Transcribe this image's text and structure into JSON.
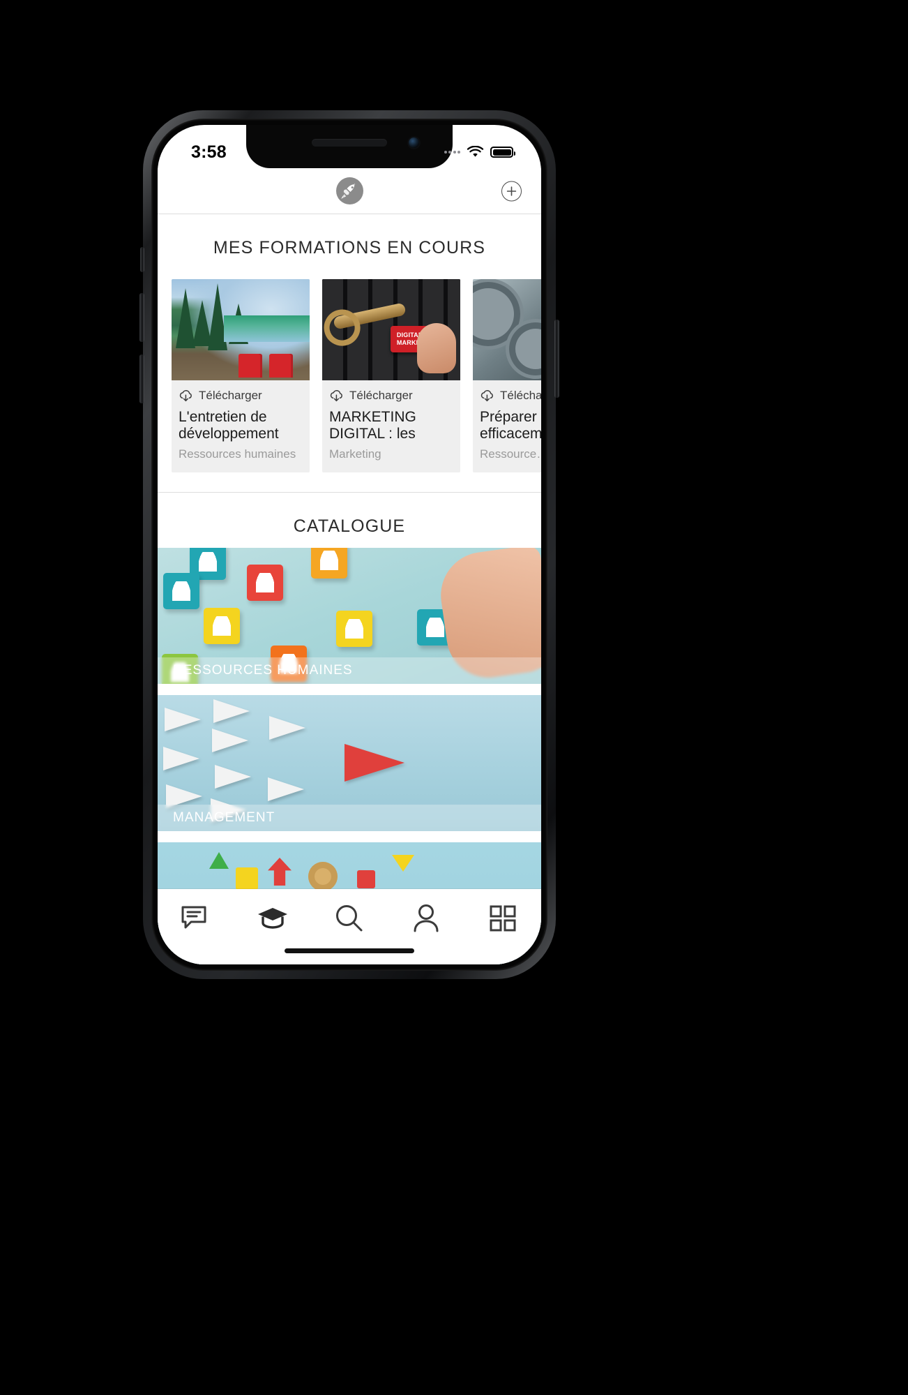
{
  "status_bar": {
    "time": "3:58",
    "signal_icon": "signal-dots-icon",
    "wifi_icon": "wifi-icon",
    "battery_icon": "battery-full-icon"
  },
  "header": {
    "logo_icon": "rocket-logo-icon",
    "add_button_icon": "plus-circle-icon",
    "add_button_label": "+"
  },
  "sections": {
    "in_progress": {
      "title": "MES FORMATIONS EN COURS",
      "courses": [
        {
          "download_label": "Télécharger",
          "download_icon": "cloud-download-icon",
          "title": "L'entretien de développement",
          "category": "Ressources humaines",
          "image_alt": "lake-forest-red-chairs"
        },
        {
          "download_label": "Télécharger",
          "download_icon": "cloud-download-icon",
          "title": "MARKETING DIGITAL : les suppo…",
          "category": "Marketing",
          "image_alt": "keyboard-digital-marketing-key"
        },
        {
          "download_label": "Télécharg…",
          "download_icon": "cloud-download-icon",
          "title": "Préparer efficacem…",
          "category": "Ressource…",
          "image_alt": "metal-gears-machinery"
        }
      ]
    },
    "catalogue": {
      "title": "CATALOGUE",
      "categories": [
        {
          "label": "RESSOURCES HUMAINES",
          "image_alt": "colorful-person-blocks-hand"
        },
        {
          "label": "MANAGEMENT",
          "image_alt": "paper-planes-red-leader"
        },
        {
          "label": "",
          "image_alt": "office-tools-flat-lay"
        }
      ]
    }
  },
  "tab_bar": {
    "items": [
      {
        "name": "messages",
        "icon": "chat-bubble-icon",
        "active": false
      },
      {
        "name": "training",
        "icon": "graduation-cap-icon",
        "active": true
      },
      {
        "name": "search",
        "icon": "magnifier-icon",
        "active": false
      },
      {
        "name": "profile",
        "icon": "user-icon",
        "active": false
      },
      {
        "name": "more",
        "icon": "grid-icon",
        "active": false
      }
    ]
  },
  "colors": {
    "accent": "#2b2b2b",
    "card_bg": "#efefef",
    "muted_text": "#9a9a9a",
    "divider": "#dedede"
  }
}
